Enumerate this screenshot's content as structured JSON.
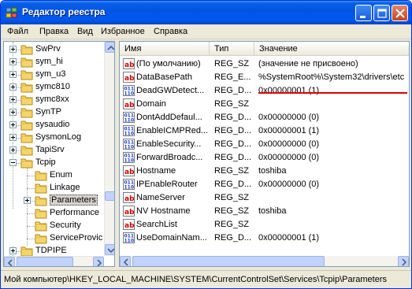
{
  "window": {
    "title": "Редактор реестра"
  },
  "menu": {
    "items": [
      "Файл",
      "Правка",
      "Вид",
      "Избранное",
      "Справка"
    ]
  },
  "tree": {
    "items": [
      {
        "label": "SwPrv",
        "expander": "plus"
      },
      {
        "label": "sym_hi",
        "expander": "plus"
      },
      {
        "label": "sym_u3",
        "expander": "plus"
      },
      {
        "label": "symc810",
        "expander": "plus"
      },
      {
        "label": "symc8xx",
        "expander": "plus"
      },
      {
        "label": "SynTP",
        "expander": "plus"
      },
      {
        "label": "sysaudio",
        "expander": "plus"
      },
      {
        "label": "SysmonLog",
        "expander": "plus"
      },
      {
        "label": "TapiSrv",
        "expander": "plus"
      },
      {
        "label": "Tcpip",
        "expander": "minus"
      },
      {
        "label": "Enum",
        "expander": "none"
      },
      {
        "label": "Linkage",
        "expander": "none"
      },
      {
        "label": "Parameters",
        "expander": "plus",
        "selected": true
      },
      {
        "label": "Performance",
        "expander": "none"
      },
      {
        "label": "Security",
        "expander": "none"
      },
      {
        "label": "ServiceProvic",
        "expander": "none"
      },
      {
        "label": "TDPIPE",
        "expander": "plus"
      }
    ]
  },
  "list": {
    "columns": [
      "Имя",
      "Тип",
      "Значение"
    ],
    "rows": [
      {
        "icon": "string-value-icon",
        "name": "(По умолчанию)",
        "type": "REG_SZ",
        "value": "(значение не присвоено)"
      },
      {
        "icon": "string-value-icon",
        "name": "DataBasePath",
        "type": "REG_E...",
        "value": "%SystemRoot%\\System32\\drivers\\etc",
        "highlighted": true
      },
      {
        "icon": "binary-value-icon",
        "name": "DeadGWDetect...",
        "type": "REG_D...",
        "value": "0x00000001 (1)"
      },
      {
        "icon": "string-value-icon",
        "name": "Domain",
        "type": "REG_SZ",
        "value": ""
      },
      {
        "icon": "binary-value-icon",
        "name": "DontAddDefaul...",
        "type": "REG_D...",
        "value": "0x00000000 (0)"
      },
      {
        "icon": "binary-value-icon",
        "name": "EnableICMPRed...",
        "type": "REG_D...",
        "value": "0x00000001 (1)"
      },
      {
        "icon": "binary-value-icon",
        "name": "EnableSecurity...",
        "type": "REG_D...",
        "value": "0x00000000 (0)"
      },
      {
        "icon": "binary-value-icon",
        "name": "ForwardBroadc...",
        "type": "REG_D...",
        "value": "0x00000000 (0)"
      },
      {
        "icon": "string-value-icon",
        "name": "Hostname",
        "type": "REG_SZ",
        "value": "toshiba"
      },
      {
        "icon": "binary-value-icon",
        "name": "IPEnableRouter",
        "type": "REG_D...",
        "value": "0x00000000 (0)"
      },
      {
        "icon": "string-value-icon",
        "name": "NameServer",
        "type": "REG_SZ",
        "value": ""
      },
      {
        "icon": "string-value-icon",
        "name": "NV Hostname",
        "type": "REG_SZ",
        "value": "toshiba"
      },
      {
        "icon": "string-value-icon",
        "name": "SearchList",
        "type": "REG_SZ",
        "value": ""
      },
      {
        "icon": "binary-value-icon",
        "name": "UseDomainNam...",
        "type": "REG_D...",
        "value": "0x00000001 (1)"
      }
    ]
  },
  "status": {
    "path": "Мой компьютер\\HKEY_LOCAL_MACHINE\\SYSTEM\\CurrentControlSet\\Services\\Tcpip\\Parameters"
  },
  "colors": {
    "title_bar": "#0054e3",
    "highlight_underline": "#e00000",
    "selected_bg": "#d6d3ce"
  }
}
